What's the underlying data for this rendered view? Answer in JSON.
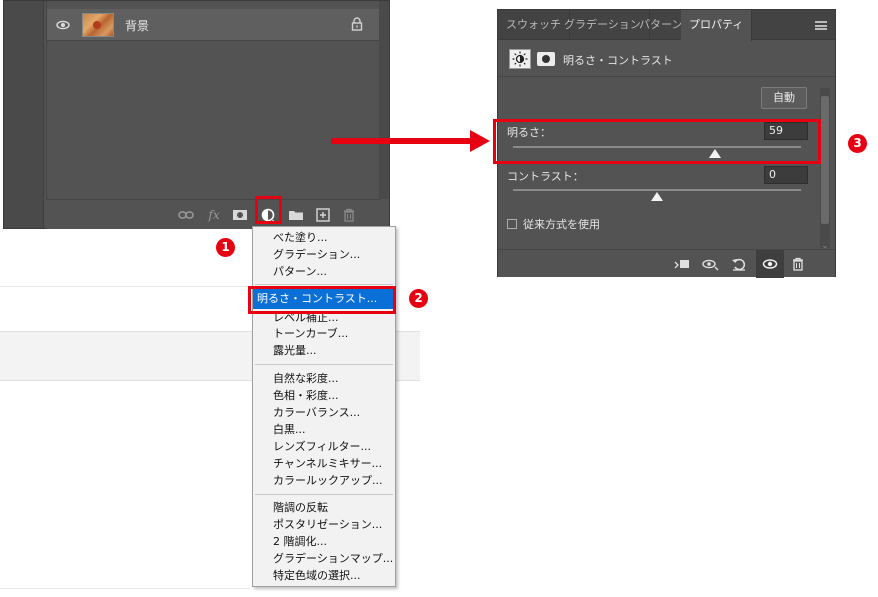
{
  "layers_panel": {
    "layer": {
      "name": "背景"
    },
    "toolbar_icons": [
      "link-icon",
      "fx-icon",
      "mask-icon",
      "adjustment-icon",
      "folder-icon",
      "new-layer-icon",
      "trash-icon"
    ],
    "fx_label": "fx"
  },
  "badges": {
    "one": "1",
    "two": "2",
    "three": "3"
  },
  "adjustment_menu": {
    "items": [
      "べた塗り...",
      "グラデーション...",
      "パターン...",
      "明るさ・コントラスト...",
      "レベル補正...",
      "トーンカーブ...",
      "露光量...",
      "自然な彩度...",
      "色相・彩度...",
      "カラーバランス...",
      "白黒...",
      "レンズフィルター...",
      "チャンネルミキサー...",
      "カラールックアップ...",
      "階調の反転",
      "ポスタリゼーション...",
      "2 階調化...",
      "グラデーションマップ...",
      "特定色域の選択..."
    ],
    "highlighted": "明るさ・コントラスト..."
  },
  "properties_panel": {
    "tabs": [
      "スウォッチ",
      "グラデーション",
      "パターン",
      "プロパティ"
    ],
    "active_tab": "プロパティ",
    "header_title": "明るさ・コントラスト",
    "auto_label": "自動",
    "brightness": {
      "label": "明るさ：",
      "value": "59",
      "level_fraction": 0.7
    },
    "contrast": {
      "label": "コントラスト：",
      "value": "0",
      "level_fraction": 0.5
    },
    "legacy_label": "従来方式を使用",
    "footer_icons": [
      "clip-icon",
      "view-previous-icon",
      "reset-icon",
      "visibility-eye-icon",
      "trash-icon"
    ]
  },
  "colors": {
    "accent_red": "#e60012",
    "highlight_blue": "#0a6fd6",
    "panel_gray": "#535353"
  }
}
